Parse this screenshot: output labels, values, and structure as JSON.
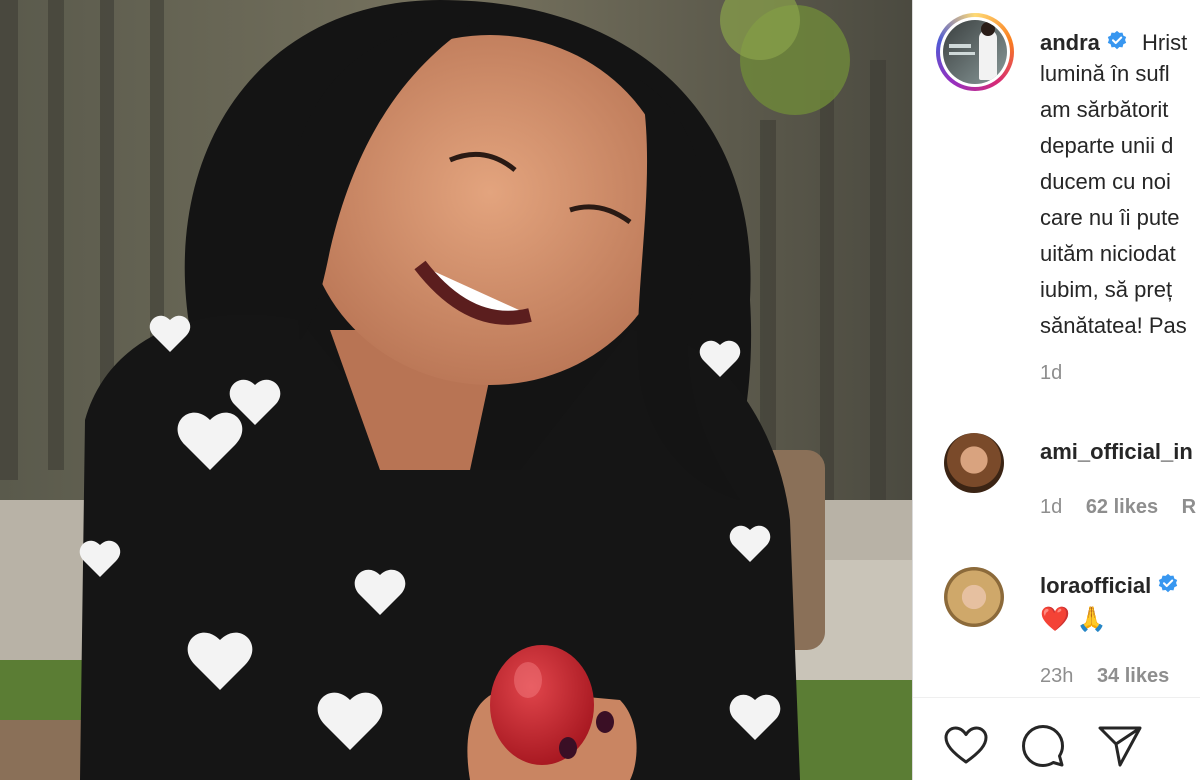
{
  "post": {
    "author": "andra",
    "caption_first": "Hrist",
    "caption_lines": [
      "lumină în sufl",
      "am sărbătorit",
      "departe unii d",
      "ducem cu noi",
      "care nu îi pute",
      "uităm niciodat",
      "iubim, să preț",
      "sănătatea! Pas"
    ],
    "age": "1d"
  },
  "comments": [
    {
      "username": "ami_official_in",
      "text": "",
      "age": "1d",
      "likes": "62 likes",
      "reply": "R"
    },
    {
      "username": "loraofficial",
      "text": "❤️ 🙏",
      "age": "23h",
      "likes": "34 likes",
      "reply": ""
    }
  ],
  "icons": {
    "like": "heart-icon",
    "comment": "comment-icon",
    "share": "share-icon",
    "verified": "verified-badge-icon"
  },
  "colors": {
    "verified": "#3897f0",
    "text": "#262626",
    "muted": "#8e8e8e",
    "heart": "#e0245e"
  }
}
